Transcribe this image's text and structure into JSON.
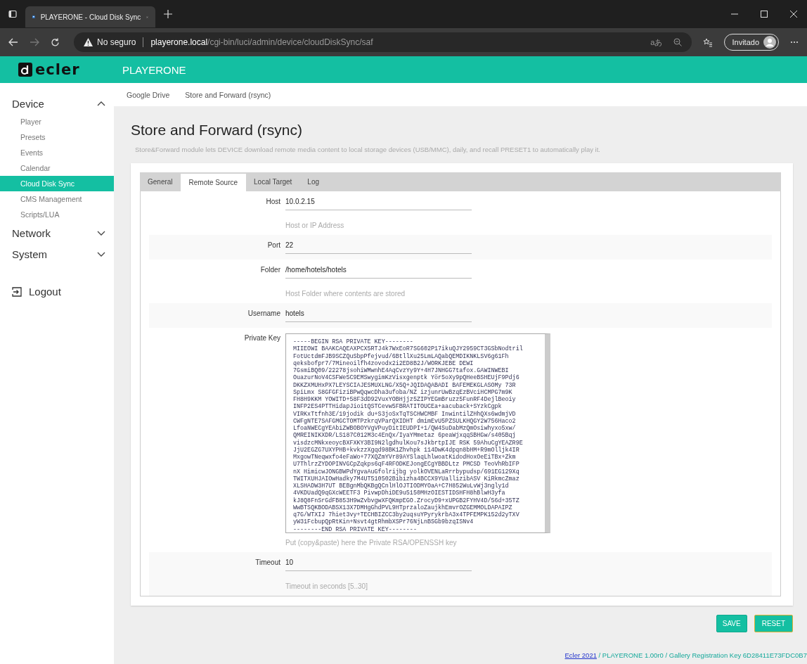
{
  "browser": {
    "tab_title": "PLAYERONE - Cloud Disk Sync",
    "security": "No seguro",
    "url_host": "playerone.local",
    "url_path": "/cgi-bin/luci/admin/device/cloudDiskSync/saf",
    "read_aloud": "aあ",
    "profile": "Invitado"
  },
  "header": {
    "logo": "ecler",
    "title": "PLAYERONE"
  },
  "sidebar": {
    "groups": [
      {
        "label": "Device",
        "expanded": true,
        "items": [
          {
            "label": "Player",
            "selected": false
          },
          {
            "label": "Presets",
            "selected": false
          },
          {
            "label": "Events",
            "selected": false
          },
          {
            "label": "Calendar",
            "selected": false
          },
          {
            "label": "Cloud Disk Sync",
            "selected": true
          },
          {
            "label": "CMS Management",
            "selected": false
          },
          {
            "label": "Scripts/LUA",
            "selected": false
          }
        ]
      },
      {
        "label": "Network",
        "expanded": false
      },
      {
        "label": "System",
        "expanded": false
      }
    ],
    "logout": "Logout"
  },
  "breadcrumb": [
    {
      "label": "Google Drive"
    },
    {
      "label": "Store and Forward (rsync)"
    }
  ],
  "page": {
    "title": "Store and Forward (rsync)",
    "description": "Store&Forward module lets DEVICE download remote media content to local storage devices (USB/MMC), daily, and recall PRESET1 to automatically play it."
  },
  "tabs": [
    {
      "label": "General",
      "selected": false
    },
    {
      "label": "Remote Source",
      "selected": true
    },
    {
      "label": "Local Target",
      "selected": false
    },
    {
      "label": "Log",
      "selected": false
    }
  ],
  "fields": [
    {
      "kind": "text",
      "label": "Host",
      "value": "10.0.2.15",
      "hint": "Host or IP Address"
    },
    {
      "kind": "text",
      "label": "Port",
      "value": "22"
    },
    {
      "kind": "text",
      "label": "Folder",
      "value": "/home/hotels/hotels",
      "hint": "Host Folder where contents are stored"
    },
    {
      "kind": "text",
      "label": "Username",
      "value": "hotels"
    },
    {
      "kind": "textarea",
      "label": "Private Key",
      "value": "-----BEGIN RSA PRIVATE KEY--------\nMIIEOWI BAAKCAQEAXPCX5RTJ4k7WxEoR7SG602P17ikuQJY2959CT3GSbNodtril\nFotUctdmFJB9SCZQuSbpPfejvud/6BtllXu25LmLAQabQEMDIKNKLSV6g61Fh\nqeksbofpr7/7Mineoilfh4zovodx2i2ED8B2J/WORKJEBE DEWI\n7GsmiBQ09/22278jsohiWMwnhE4AqCvzYy9Y+4H7JNHGG7tafox.GAWINWEBI\nOuazurNoV4CSFWe5C9EMSwygimKzVisxgenptk Yör5oXy9pQHeeBSHEUjF9Pdj6\nDKKZXMUHxPX7LEYSCIAJESMUXLNG/X5Q+JQIDAQABADI BAFEMEKGLASOMy 73R\nSpiLmx S8GFGFiziBPwQqwcDha3ufoba/NZ izjunrUwBzqEzBVciHCMPG7m9K\nFH8H9KKM YOWITD+58F3dD92VuxYOBHjjz5ZIPYEGmBruzz5FunRF4DejlBeoiy\nINFP2ES4PTTHidapJioitQSTCevw5FBRATITOUCEa+aacuback+SYzkCgpk\nVIRKxTtfnh3E/19jodik du+S3joSxTqTSCHWCMBF InwintilZHhQXs6wdmjVD\nCWFgNTE7SAFGMGCTOMTPzkrqVParQXIDHT dmimEvU5PZSULKHQGY2W756Haco2\nLfoaNWECgYEAbiZWBOBOYVgVPuyDitIEUDPI+1/QW4SuDabMzQmOsiwhyxo5xw/\nQMREINIKXDR/LS187C012M3c4EnQx/IyaYMmetaz 6peaWjxqqSBHGw/s405Bqj\nvisdzcMNkxeoycBXFXKY3BI9N2lgdhulKou7sJkbrtpIJE RSK 59AhuCgYEAZR9E\nJjU2EGZG7UXYPHB+kvkzzXgqd98BK1Zhvhpk 114DwK4dpqn8bHM+R9mOlljk4IR\nMxgowTNeqwxfo4eFaWo+77XQZmYVr89AYSlaqLhlwoatKidodHoxOeEiTBx+Zkm\nU7ThlrzZYDOPINVGCpZqkps6qF4RFODKEJongECgYBBDLtz PMCSD TeoVhRbIFP\nnX HimicwJONGBWPdYgvaAuGfolrijbg yolkOVENLaRrrbypudsp/691EG129Xq\nTWITXUHJAIOwHadky7M4UT510502Bibizha4BCCX9YUallizibASV KiRkmcZmaz\nXLSHADW3H7UT BEBgnMbQKBgQCnlHlOJTIODMYOaA+C7H852WuLvWj3ngly1d\n4VKDUadQ9qGXcWEETF3 PivwpDhiDE9u5150MHzOIESTIDSHFH8hBlwH3yfa\nkJ8Q8FnSrGdFB853H9wZvbvgwXFQKmpEGO.ZrocyD9+xUPGB2FYHV4D/56d+35TZ\nWwBTSQKBODABSX13X7DMHgGhdPVL9HTprzaloZaujkhEmvrOZGEMMOLDAPAIPZ\nq7G/WTXIJ 7hiet3vy+TECHBIZCC3by2uqsuYPyrykrbA3x4TPFEMPK152d2yTXV\nyW31FcbupQpRtKin+Nsvt4gtRhmbXSPr76NjLnBSGb9bzqISNv4\n--------END RSA PRIVATE KEY--------",
      "hint": "Put (copy&paste) here the Private RSA/OPENSSH key"
    },
    {
      "kind": "text",
      "label": "Timeout",
      "value": "10",
      "hint": "Timeout in seconds [5..30]"
    }
  ],
  "buttons": [
    {
      "label": "SAVE"
    },
    {
      "label": "RESET"
    }
  ],
  "footer": {
    "link": "Ecler 2021",
    "text": "/ PLAYERONE 1.00r0 / Gallery Registration Key 6D28411E73FDC0B7"
  }
}
